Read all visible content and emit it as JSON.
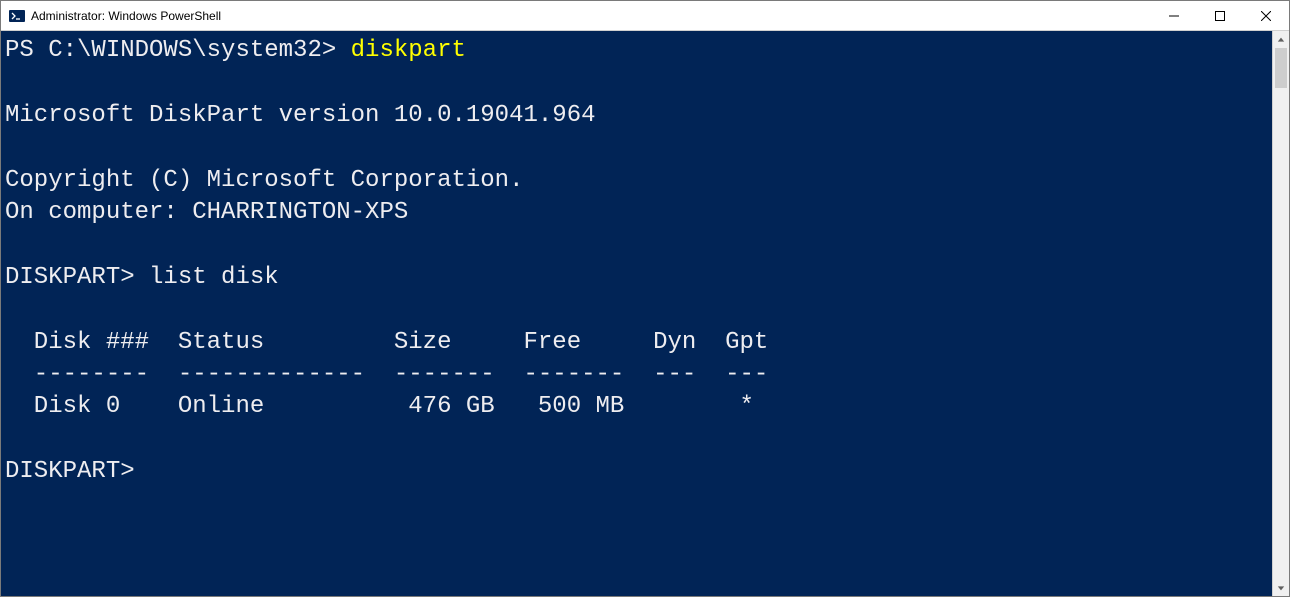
{
  "window": {
    "title": "Administrator: Windows PowerShell"
  },
  "terminal": {
    "prompt1": "PS C:\\WINDOWS\\system32> ",
    "cmd1": "diskpart",
    "blank": "",
    "version": "Microsoft DiskPart version 10.0.19041.964",
    "copyright": "Copyright (C) Microsoft Corporation.",
    "computer": "On computer: CHARRINGTON-XPS",
    "prompt2": "DISKPART> list disk",
    "table_header": "  Disk ###  Status         Size     Free     Dyn  Gpt",
    "table_divider": "  --------  -------------  -------  -------  ---  ---",
    "table_row0": "  Disk 0    Online          476 GB   500 MB        *",
    "prompt3": "DISKPART> "
  }
}
